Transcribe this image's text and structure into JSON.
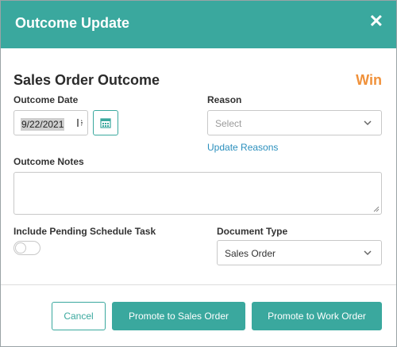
{
  "header": {
    "title": "Outcome Update",
    "close_glyph": "✕"
  },
  "section": {
    "title": "Sales Order Outcome",
    "status": "Win"
  },
  "outcome_date": {
    "label": "Outcome Date",
    "value": "9/22/2021",
    "spin_glyph": "▯↕"
  },
  "reason": {
    "label": "Reason",
    "placeholder": "Select",
    "link": "Update Reasons"
  },
  "notes": {
    "label": "Outcome Notes",
    "value": ""
  },
  "pending": {
    "label": "Include Pending Schedule Task",
    "checked": false
  },
  "document_type": {
    "label": "Document Type",
    "value": "Sales Order"
  },
  "footer": {
    "cancel": "Cancel",
    "promote_sales": "Promote to Sales Order",
    "promote_work": "Promote to Work Order"
  },
  "colors": {
    "accent": "#3aa89e",
    "win": "#f0913a",
    "link": "#2a8fbd"
  }
}
